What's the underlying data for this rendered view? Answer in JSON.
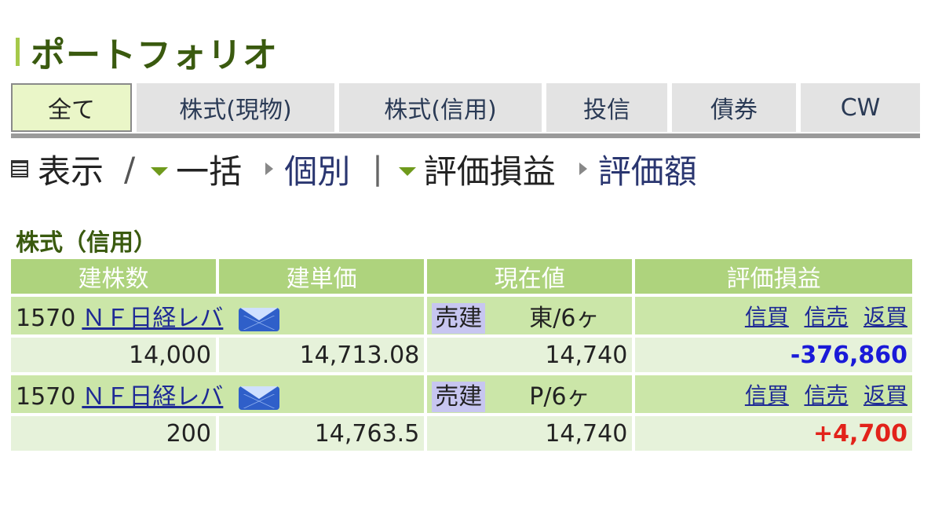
{
  "page": {
    "title": "ポートフォリオ"
  },
  "tabs": [
    {
      "label": "全て",
      "active": true
    },
    {
      "label": "株式(現物)"
    },
    {
      "label": "株式(信用)"
    },
    {
      "label": "投信"
    },
    {
      "label": "債券"
    },
    {
      "label": "CW"
    }
  ],
  "viewbar": {
    "display_label": "表示",
    "slash": "/",
    "bulk": "一括",
    "individual": "個別",
    "sep": "|",
    "pl": "評価損益",
    "amount": "評価額"
  },
  "section": {
    "title": "株式（信用）",
    "headers": [
      "建株数",
      "建単価",
      "現在値",
      "評価損益"
    ],
    "rows": [
      {
        "code": "1570",
        "name": "ＮＦ日経レバ",
        "type": "売建",
        "market": "東/6ヶ",
        "actions": [
          "信買",
          "信売",
          "返買"
        ],
        "shares": "14,000",
        "unit_price": "14,713.08",
        "current_price": "14,740",
        "pl": "-376,860"
      },
      {
        "code": "1570",
        "name": "ＮＦ日経レバ",
        "type": "売建",
        "market": "P/6ヶ",
        "actions": [
          "信買",
          "信売",
          "返買"
        ],
        "shares": "200",
        "unit_price": "14,763.5",
        "current_price": "14,740",
        "pl": "+4,700"
      }
    ]
  },
  "icons": {
    "list": "list-icon",
    "mail": "mail-icon"
  },
  "colors": {
    "accent": "#a5c94a",
    "title": "#3a5a0f",
    "header": "#aed37d",
    "negative": "#1a1ad8",
    "positive": "#e2231a"
  }
}
